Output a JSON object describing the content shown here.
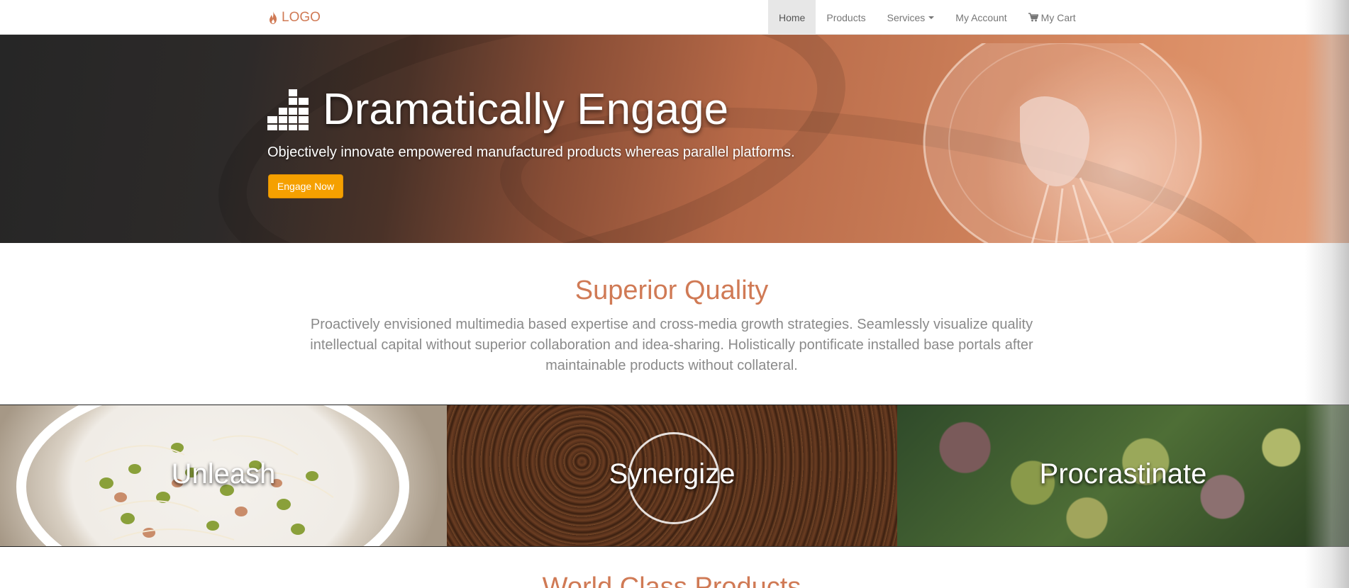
{
  "navbar": {
    "brand": "LOGO",
    "items": [
      {
        "label": "Home",
        "active": true
      },
      {
        "label": "Products",
        "active": false
      },
      {
        "label": "Services",
        "active": false
      },
      {
        "label": "My Account",
        "active": false
      },
      {
        "label": "My Cart",
        "active": false
      }
    ],
    "icons": {
      "brand": "flame-icon",
      "cart": "shopping-cart-icon",
      "dropdown": "caret-down-icon"
    }
  },
  "hero": {
    "title": "Dramatically Engage",
    "subtitle": "Objectively innovate empowered manufactured products whereas parallel platforms.",
    "button_label": "Engage Now",
    "icon": "bar-chart-icon"
  },
  "quality": {
    "title": "Superior Quality",
    "text": "Proactively envisioned multimedia based expertise and cross-media growth strategies. Seamlessly visualize quality intellectual capital without superior collaboration and idea-sharing. Holistically pontificate installed base portals after maintainable products without collateral."
  },
  "tiles": [
    {
      "label": "Unleash"
    },
    {
      "label": "Synergize"
    },
    {
      "label": "Procrastinate"
    }
  ],
  "next_section": {
    "title": "World Class Products"
  },
  "colors": {
    "brand": "#d07a55",
    "button": "#f5a000",
    "nav_active_bg": "#e7e7e7",
    "body_text": "#8a8a8a"
  }
}
